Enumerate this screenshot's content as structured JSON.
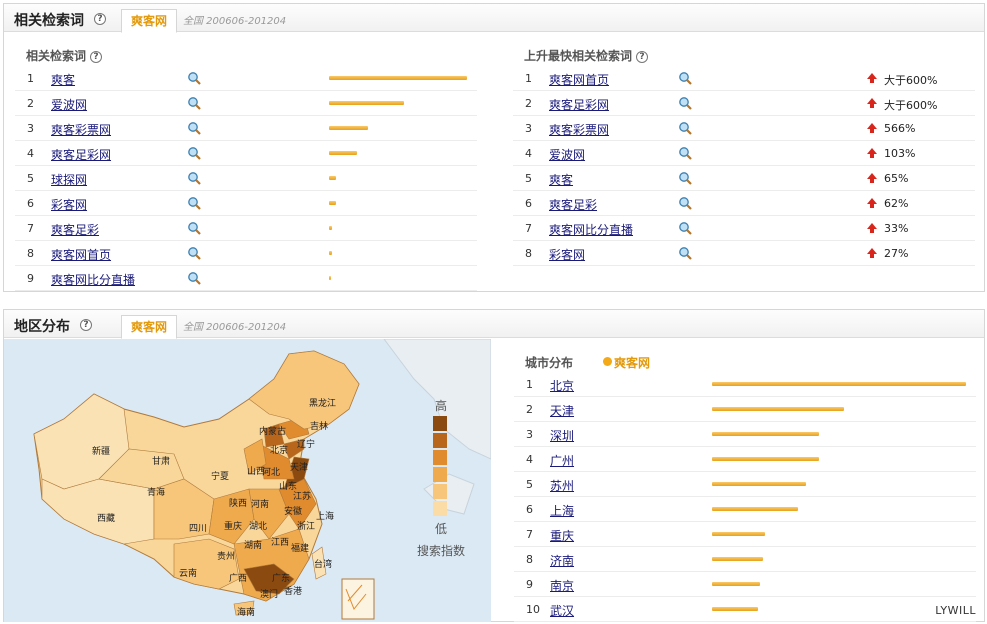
{
  "top_panel": {
    "title": "相关检索词",
    "help": "?",
    "tab": "爽客网",
    "range": "全国 200606-201204",
    "related": {
      "title": "相关检索词",
      "rows": [
        {
          "rank": "1",
          "keyword": "爽客",
          "score": 1.0
        },
        {
          "rank": "2",
          "keyword": "爱波网",
          "score": 0.54
        },
        {
          "rank": "3",
          "keyword": "爽客彩票网",
          "score": 0.28
        },
        {
          "rank": "4",
          "keyword": "爽客足彩网",
          "score": 0.2
        },
        {
          "rank": "5",
          "keyword": "球探网",
          "score": 0.05
        },
        {
          "rank": "6",
          "keyword": "彩客网",
          "score": 0.05
        },
        {
          "rank": "7",
          "keyword": "爽客足彩",
          "score": 0.02
        },
        {
          "rank": "8",
          "keyword": "爽客网首页",
          "score": 0.02
        },
        {
          "rank": "9",
          "keyword": "爽客网比分直播",
          "score": 0.01
        }
      ]
    },
    "rising": {
      "title": "上升最快相关检索词",
      "rows": [
        {
          "rank": "1",
          "keyword": "爽客网首页",
          "change": "大于600%"
        },
        {
          "rank": "2",
          "keyword": "爽客足彩网",
          "change": "大于600%"
        },
        {
          "rank": "3",
          "keyword": "爽客彩票网",
          "change": "566%"
        },
        {
          "rank": "4",
          "keyword": "爱波网",
          "change": "103%"
        },
        {
          "rank": "5",
          "keyword": "爽客",
          "change": "65%"
        },
        {
          "rank": "6",
          "keyword": "爽客足彩",
          "change": "62%"
        },
        {
          "rank": "7",
          "keyword": "爽客网比分直播",
          "change": "33%"
        },
        {
          "rank": "8",
          "keyword": "彩客网",
          "change": "27%"
        }
      ]
    }
  },
  "bottom_panel": {
    "title": "地区分布",
    "help": "?",
    "tab": "爽客网",
    "range": "全国 200606-201204",
    "map": {
      "legend_high": "高",
      "legend_low": "低",
      "legend_caption": "搜索指数",
      "legend_colors": [
        "#8b4a10",
        "#b8661c",
        "#e08b2e",
        "#f0aa4e",
        "#f7c67a",
        "#fbdca6"
      ],
      "provinces": [
        {
          "label": "黑龙江"
        },
        {
          "label": "吉林"
        },
        {
          "label": "辽宁"
        },
        {
          "label": "内蒙古"
        },
        {
          "label": "北京"
        },
        {
          "label": "天津"
        },
        {
          "label": "河北"
        },
        {
          "label": "山西"
        },
        {
          "label": "山东"
        },
        {
          "label": "新疆"
        },
        {
          "label": "甘肃"
        },
        {
          "label": "宁夏"
        },
        {
          "label": "陕西"
        },
        {
          "label": "河南"
        },
        {
          "label": "江苏"
        },
        {
          "label": "安徽"
        },
        {
          "label": "上海"
        },
        {
          "label": "青海"
        },
        {
          "label": "西藏"
        },
        {
          "label": "四川"
        },
        {
          "label": "重庆"
        },
        {
          "label": "湖北"
        },
        {
          "label": "浙江"
        },
        {
          "label": "湖南"
        },
        {
          "label": "江西"
        },
        {
          "label": "福建"
        },
        {
          "label": "贵州"
        },
        {
          "label": "云南"
        },
        {
          "label": "广西"
        },
        {
          "label": "广东"
        },
        {
          "label": "台湾"
        },
        {
          "label": "香港"
        },
        {
          "label": "澳门"
        },
        {
          "label": "海南"
        }
      ]
    },
    "cities": {
      "title": "城市分布",
      "legend_label": "爽客网",
      "rows": [
        {
          "rank": "1",
          "city": "北京",
          "score": 1.0
        },
        {
          "rank": "2",
          "city": "天津",
          "score": 0.52
        },
        {
          "rank": "3",
          "city": "深圳",
          "score": 0.42
        },
        {
          "rank": "4",
          "city": "广州",
          "score": 0.42
        },
        {
          "rank": "5",
          "city": "苏州",
          "score": 0.37
        },
        {
          "rank": "6",
          "city": "上海",
          "score": 0.34
        },
        {
          "rank": "7",
          "city": "重庆",
          "score": 0.21
        },
        {
          "rank": "8",
          "city": "济南",
          "score": 0.2
        },
        {
          "rank": "9",
          "city": "南京",
          "score": 0.19
        },
        {
          "rank": "10",
          "city": "武汉",
          "score": 0.18
        }
      ]
    },
    "watermark": "LYWILL"
  },
  "colors": {
    "accent": "#e39a0c",
    "bar": "#f0a830",
    "link": "#1a1a7a",
    "up": "#d9261c"
  }
}
